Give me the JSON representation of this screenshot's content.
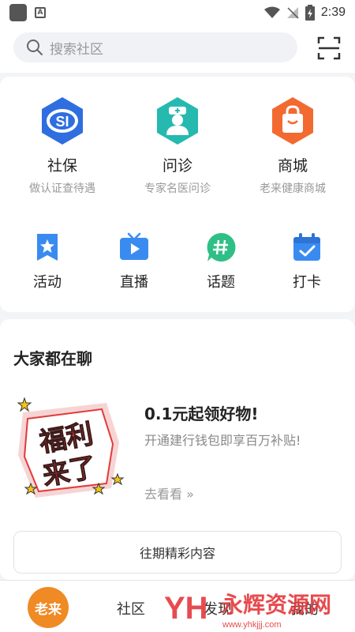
{
  "status_bar": {
    "time": "2:39"
  },
  "header": {
    "search_placeholder": "搜索社区"
  },
  "services": [
    {
      "title": "社保",
      "subtitle": "做认证查待遇",
      "icon": "social-security-icon",
      "color": "#2f6ee0"
    },
    {
      "title": "问诊",
      "subtitle": "专家名医问诊",
      "icon": "doctor-icon",
      "color": "#25b9b0"
    },
    {
      "title": "商城",
      "subtitle": "老来健康商城",
      "icon": "shopping-bag-icon",
      "color": "#f26a2f"
    }
  ],
  "mini_services": [
    {
      "label": "活动",
      "icon": "activity-flag-icon"
    },
    {
      "label": "直播",
      "icon": "live-tv-icon"
    },
    {
      "label": "话题",
      "icon": "topic-hash-icon"
    },
    {
      "label": "打卡",
      "icon": "checkin-calendar-icon"
    }
  ],
  "discussion": {
    "title": "大家都在聊",
    "promo": {
      "badge_line1": "福利",
      "badge_line2": "来了",
      "title": "0.1元起领好物!",
      "subtitle": "开通建行钱包即享百万补贴!",
      "link": "去看看 »"
    },
    "history_button": "往期精彩内容"
  },
  "bottom_nav": {
    "logo_text": "老来",
    "items": [
      "社区",
      "发现",
      "我的"
    ]
  },
  "watermark": {
    "brand": "永辉资源网",
    "url": "www.yhkjjj.com"
  }
}
